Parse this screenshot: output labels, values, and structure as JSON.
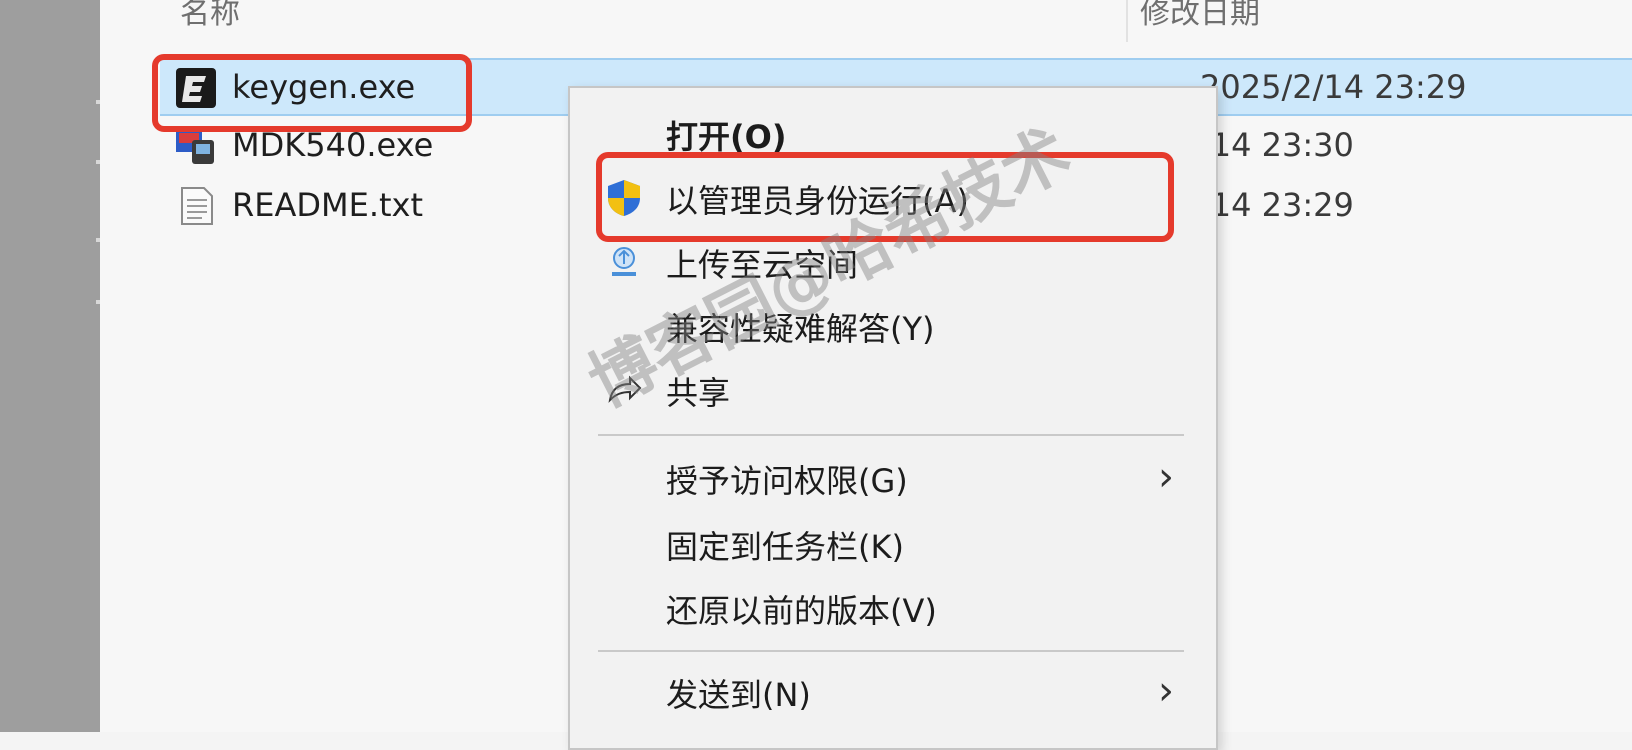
{
  "explorer": {
    "header": {
      "name_label": "名称",
      "date_label": "修改日期"
    },
    "files": [
      {
        "name": "keygen.exe",
        "date": "2025/2/14 23:29",
        "icon": "keygen-app-icon",
        "selected": true
      },
      {
        "name": "MDK540.exe",
        "date": "/14 23:30",
        "icon": "installer-app-icon",
        "selected": false
      },
      {
        "name": "README.txt",
        "date": "/14 23:29",
        "icon": "text-file-icon",
        "selected": false
      }
    ]
  },
  "context_menu": {
    "items": [
      {
        "label": "打开(O)"
      },
      {
        "label": "以管理员身份运行(A)",
        "icon": "uac-shield-icon"
      },
      {
        "label": "上传至云空间",
        "icon": "cloud-upload-icon"
      },
      {
        "label": "兼容性疑难解答(Y)"
      },
      {
        "label": "共享",
        "icon": "share-icon"
      },
      {
        "label": "授予访问权限(G)",
        "submenu": true
      },
      {
        "label": "固定到任务栏(K)"
      },
      {
        "label": "还原以前的版本(V)"
      },
      {
        "label": "发送到(N)",
        "submenu": true
      }
    ]
  },
  "watermark": "博客园@哈希技术",
  "colors": {
    "highlight": "#e53a2c",
    "selection": "#cde8fb"
  }
}
